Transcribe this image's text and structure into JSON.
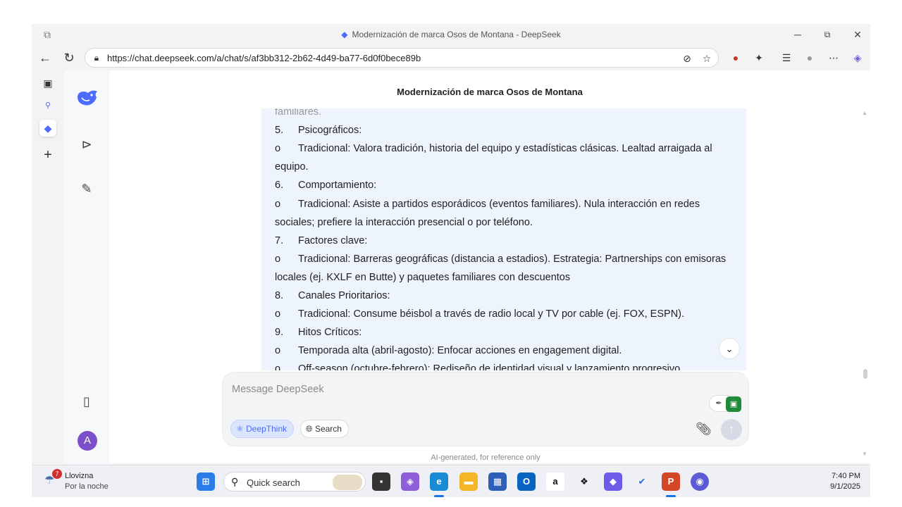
{
  "browser": {
    "window_title": "Modernización de marca Osos de Montana - DeepSeek",
    "url": "https://chat.deepseek.com/a/chat/s/af3bb312-2b62-4d49-ba77-6d0f0bece89b"
  },
  "chat": {
    "title": "Modernización de marca Osos de Montana",
    "lines": [
      {
        "num": "",
        "text": "familiares.",
        "faded": true
      },
      {
        "num": "5.",
        "text": "Psicográficos:"
      },
      {
        "num": "o",
        "text": "Tradicional: Valora tradición, historia del equipo y estadísticas clásicas. Lealtad arraigada al"
      },
      {
        "num": "",
        "text": "equipo."
      },
      {
        "num": "6.",
        "text": "Comportamiento:"
      },
      {
        "num": "o",
        "text": "Tradicional: Asiste a partidos esporádicos (eventos familiares). Nula interacción en redes"
      },
      {
        "num": "",
        "text": "sociales; prefiere la interacción presencial o por teléfono."
      },
      {
        "num": "7.",
        "text": "Factores clave:"
      },
      {
        "num": "o",
        "text": "Tradicional: Barreras geográficas (distancia a estadios). Estrategia: Partnerships con emisoras"
      },
      {
        "num": "",
        "text": "locales (ej. KXLF en Butte) y paquetes familiares con descuentos"
      },
      {
        "num": "8.",
        "text": "Canales Prioritarios:"
      },
      {
        "num": "o",
        "text": "Tradicional: Consume béisbol a través de radio local y TV por cable (ej. FOX, ESPN)."
      },
      {
        "num": "9.",
        "text": "Hitos Críticos:"
      },
      {
        "num": "o",
        "text": "Temporada alta (abril-agosto): Enfocar acciones en engagement digital."
      },
      {
        "num": "o",
        "text": "Off-season (octubre-febrero): Rediseño de identidad visual y lanzamiento progresivo"
      }
    ]
  },
  "composer": {
    "placeholder": "Message DeepSeek",
    "deepthink_label": "DeepThink",
    "search_label": "Search"
  },
  "disclaimer": "AI-generated, for reference only",
  "sidebar": {
    "avatar_letter": "A"
  },
  "taskbar": {
    "weather_condition": "Llovizna",
    "weather_sub": "Por la noche",
    "weather_badge": "7",
    "search_label": "Quick search",
    "time": "7:40 PM",
    "date": "9/1/2025"
  },
  "colors": {
    "accent": "#4d6bfe",
    "message_bg": "#eef4fd",
    "avatar": "#7b4fc8"
  }
}
